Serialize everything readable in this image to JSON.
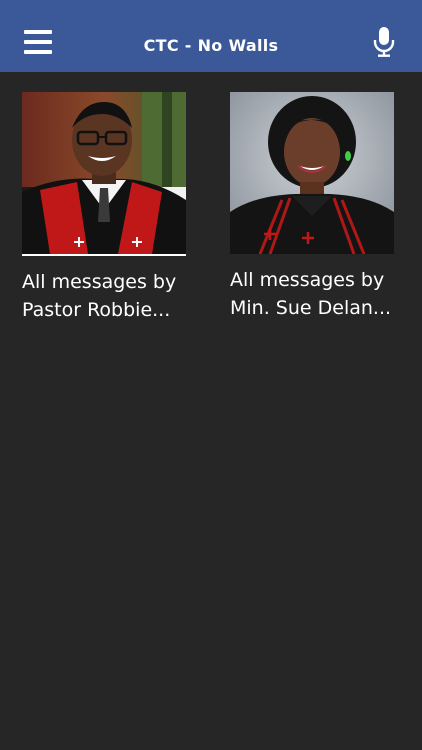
{
  "header": {
    "title": "CTC - No Walls",
    "menu_icon": "hamburger-menu-icon",
    "mic_icon": "microphone-icon"
  },
  "colors": {
    "header_bg": "#3b5998",
    "page_bg": "#262626",
    "text": "#ffffff"
  },
  "cards": [
    {
      "line1": "All messages by",
      "line2": "Pastor Robbie..."
    },
    {
      "line1": "All messages by",
      "line2": "Min. Sue Delan..."
    }
  ]
}
